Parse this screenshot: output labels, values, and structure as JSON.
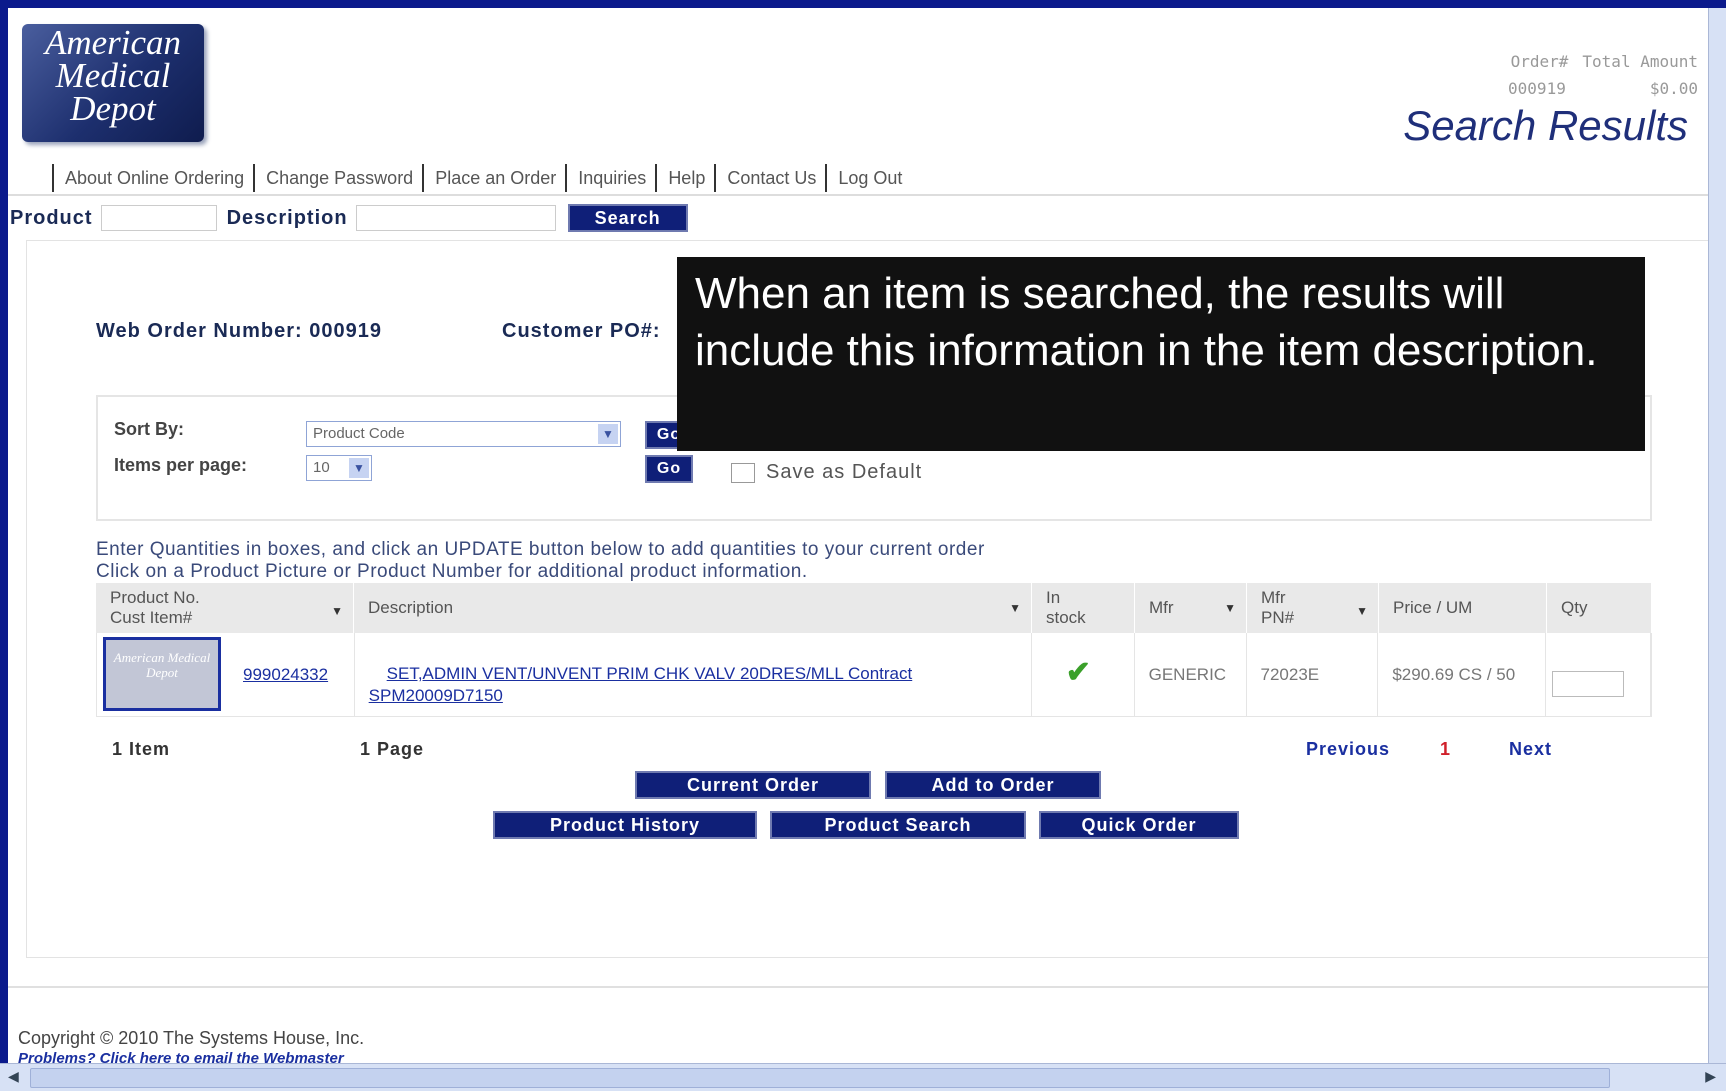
{
  "logo": {
    "line1": "American",
    "line2": "Medical",
    "line3": "Depot"
  },
  "order_summary": {
    "order_label": "Order#",
    "total_label": "Total Amount",
    "order_number": "000919",
    "total_amount": "$0.00"
  },
  "page_title": "Search Results",
  "nav": [
    "About Online Ordering",
    "Change Password",
    "Place an Order",
    "Inquiries",
    "Help",
    "Contact Us",
    "Log Out"
  ],
  "search": {
    "product_label": "Product",
    "description_label": "Description",
    "button": "Search"
  },
  "web_order": "Web Order Number: 000919",
  "customer_po": "Customer PO#:",
  "sort": {
    "sort_label": "Sort By:",
    "sort_value": "Product Code",
    "items_label": "Items per page:",
    "items_value": "10",
    "go": "Go",
    "save_default": "Save as Default"
  },
  "instructions": {
    "line1": "Enter Quantities in boxes, and click an UPDATE button below to add quantities to your current order",
    "line2": "Click on a Product Picture or Product Number for additional product information."
  },
  "table": {
    "headers": {
      "product_no": "Product No.",
      "cust_item": "Cust Item#",
      "description": "Description",
      "in_stock_1": "In",
      "in_stock_2": "stock",
      "mfr": "Mfr",
      "mfr_pn_1": "Mfr",
      "mfr_pn_2": "PN#",
      "price": "Price / UM",
      "qty": "Qty"
    },
    "rows": [
      {
        "thumb": "American Medical Depot",
        "product_no": "999024332",
        "description_1": "SET,ADMIN VENT/UNVENT PRIM CHK VALV 20DRES/MLL Contract",
        "description_2": "SPM20009D7150",
        "mfr": "GENERIC",
        "mfr_pn": "72023E",
        "price": "$290.69 CS / 50",
        "qty": ""
      }
    ]
  },
  "pager": {
    "items": "1 Item",
    "pages": "1 Page",
    "previous": "Previous",
    "current": "1",
    "next": "Next"
  },
  "actions": {
    "current_order": "Current Order",
    "add_to_order": "Add to Order",
    "product_history": "Product History",
    "product_search": "Product Search",
    "quick_order": "Quick Order"
  },
  "footer": {
    "copyright": "Copyright © 2010 The Systems House, Inc.",
    "problems": "Problems? Click here to email the Webmaster"
  },
  "tooltip": "When an item is searched, the results will include this information in the item description.",
  "colors": {
    "frame": "#0b1a8c",
    "button": "#0f1f78",
    "link": "#1a2fa0",
    "heading": "#1f2f7a"
  }
}
